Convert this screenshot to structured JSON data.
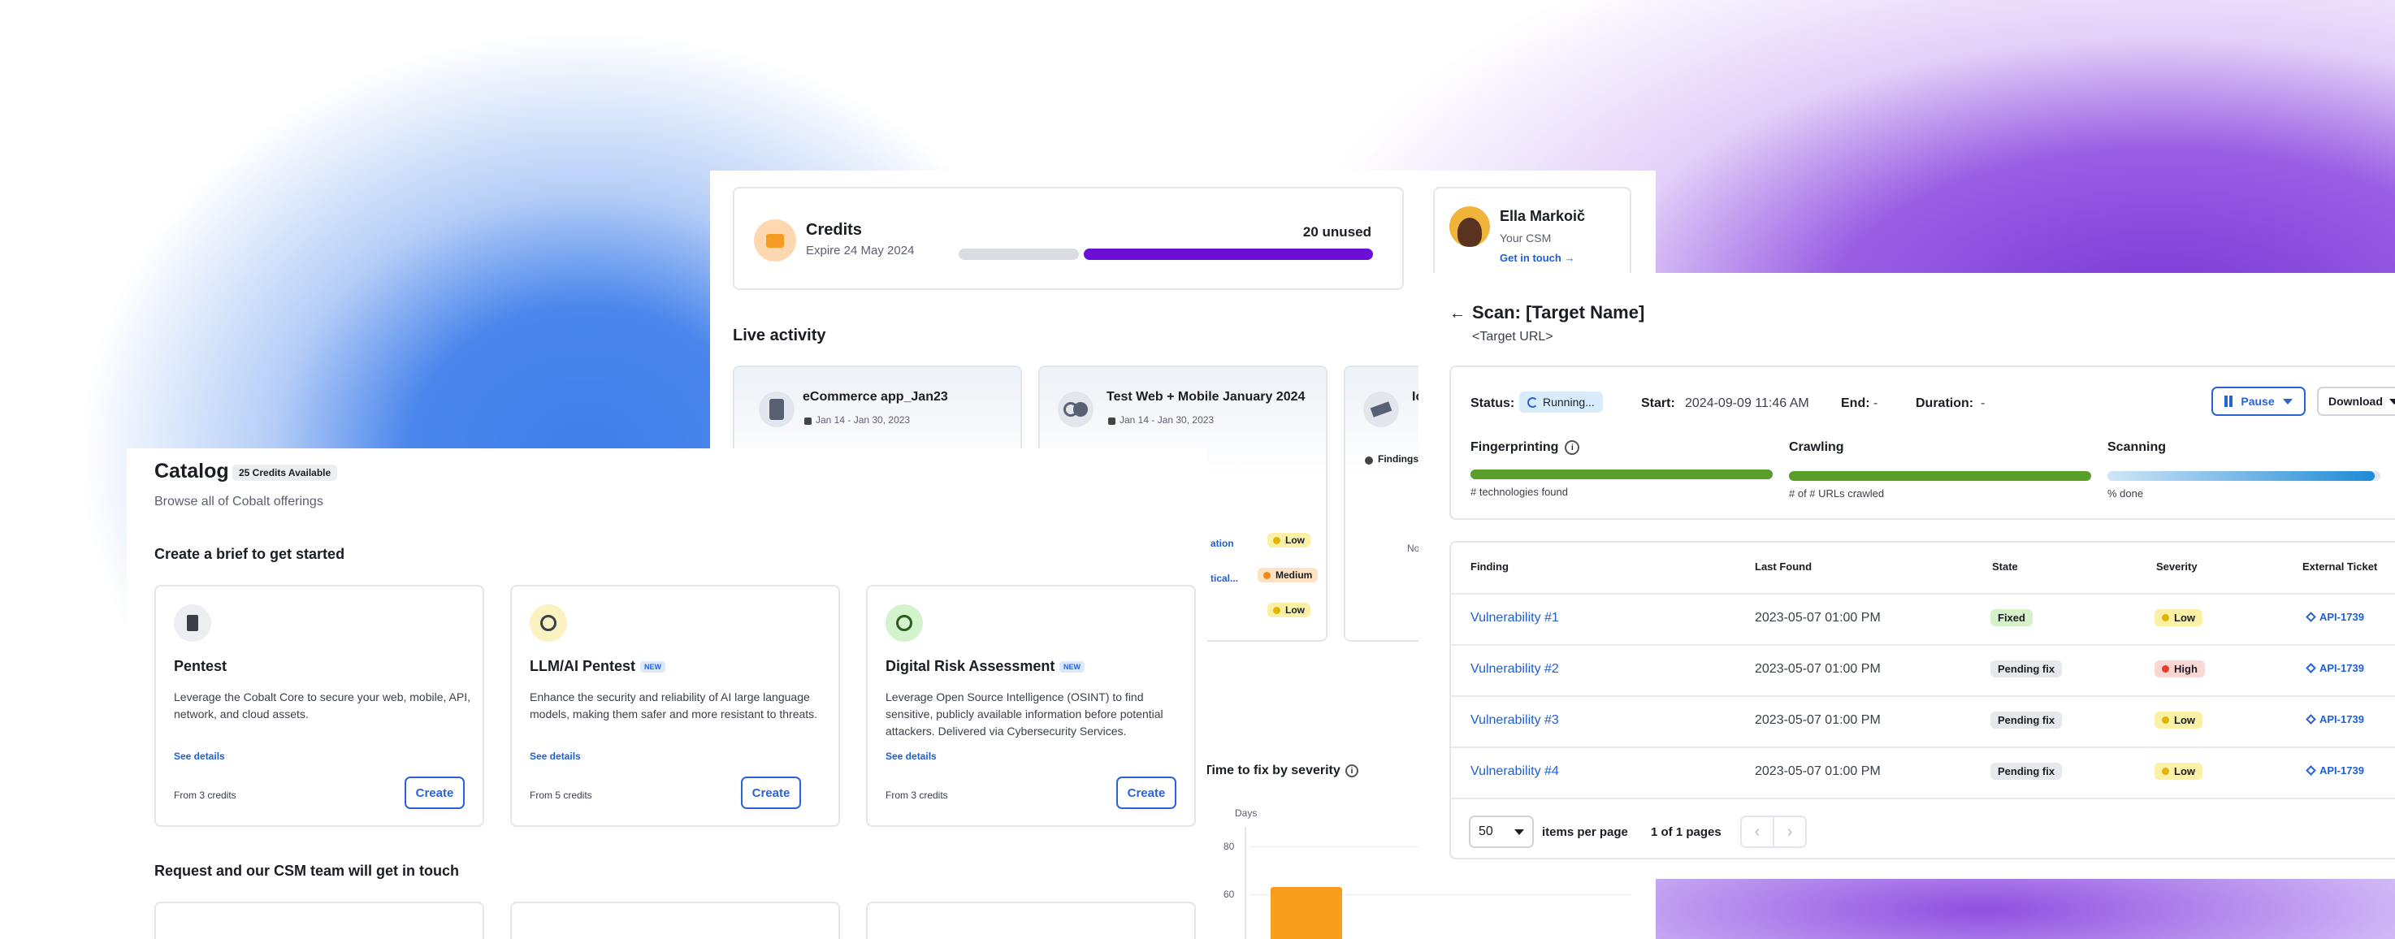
{
  "credits": {
    "title": "Credits",
    "expire": "Expire 24 May 2024",
    "unused": "20 unused",
    "used_fraction": 0.29
  },
  "csm": {
    "name": "Ella Markoič",
    "role": "Your CSM",
    "link": "Get in touch →"
  },
  "live": {
    "title": "Live activity",
    "cards": [
      {
        "name": "eCommerce app_Jan23",
        "dates": "Jan 14 - Jan 30, 2023"
      },
      {
        "name": "Test Web + Mobile January 2024",
        "dates": "Jan 14 - Jan 30, 2023"
      },
      {
        "name": "Io",
        "findings": "Findings"
      }
    ],
    "partial_links": [
      "ation",
      "tical..."
    ],
    "partial_no": "No",
    "severities": [
      "Low",
      "Medium",
      "Low"
    ]
  },
  "catalog": {
    "title": "Catalog",
    "credits_badge": "25 Credits Available",
    "subtitle": "Browse all of Cobalt offerings",
    "section1": "Create a brief to get started",
    "section2": "Request and our CSM team will get in touch",
    "items": [
      {
        "title": "Pentest",
        "new": "",
        "desc": "Leverage the Cobalt Core to secure your web, mobile, API, network, and cloud assets.",
        "details": "See details",
        "credits": "From 3 credits",
        "button": "Create"
      },
      {
        "title": "LLM/AI Pentest",
        "new": "NEW",
        "desc": "Enhance the security and reliability of AI large language models, making them safer and more resistant to threats.",
        "details": "See details",
        "credits": "From 5 credits",
        "button": "Create"
      },
      {
        "title": "Digital Risk Assessment",
        "new": "NEW",
        "desc": "Leverage Open Source Intelligence (OSINT) to find sensitive, publicly available information before potential attackers. Delivered via Cybersecurity Services.",
        "details": "See details",
        "credits": "From 3 credits",
        "button": "Create"
      }
    ]
  },
  "ttf": {
    "title": "Time to fix by severity",
    "ylabel": "Days",
    "ticks": [
      "80",
      "60"
    ]
  },
  "chart_data": {
    "type": "bar",
    "title": "Time to fix by severity",
    "ylabel": "Days",
    "ylim": [
      0,
      90
    ],
    "categories": [
      ""
    ],
    "values": [
      63
    ]
  },
  "scan": {
    "title": "Scan: [Target Name]",
    "url": "<Target URL>",
    "status_label": "Status:",
    "status_value": "Running...",
    "start_label": "Start:",
    "start_value": "2024-09-09 11:46 AM",
    "end_label": "End:",
    "end_value": "-",
    "duration_label": "Duration:",
    "duration_value": "-",
    "pause": "Pause",
    "download": "Download",
    "phases": [
      {
        "name": "Fingerprinting",
        "sub": "# technologies found",
        "progress": 1.0
      },
      {
        "name": "Crawling",
        "sub": "# of # URLs crawled",
        "progress": 1.0
      },
      {
        "name": "Scanning",
        "sub": "% done",
        "progress": 0.98
      }
    ],
    "columns": [
      "Finding",
      "Last Found",
      "State",
      "Severity",
      "External Ticket"
    ],
    "rows": [
      {
        "finding": "Vulnerability #1",
        "last_found": "2023-05-07 01:00 PM",
        "state": "Fixed",
        "severity": "Low",
        "ticket": "API-1739"
      },
      {
        "finding": "Vulnerability #2",
        "last_found": "2023-05-07 01:00 PM",
        "state": "Pending fix",
        "severity": "High",
        "ticket": "API-1739"
      },
      {
        "finding": "Vulnerability #3",
        "last_found": "2023-05-07 01:00 PM",
        "state": "Pending fix",
        "severity": "Low",
        "ticket": "API-1739"
      },
      {
        "finding": "Vulnerability #4",
        "last_found": "2023-05-07 01:00 PM",
        "state": "Pending fix",
        "severity": "Low",
        "ticket": "API-1739"
      }
    ],
    "per_page": "50",
    "per_page_label": "items per page",
    "pages": "1 of 1 pages"
  },
  "colors": {
    "accent": "#2a62d8",
    "purple": "#6a0fd4",
    "green": "#5a9e2a",
    "low": "#fbf1a6",
    "high": "#fbd6d2",
    "medium": "#fde3c4",
    "fixed": "#d6f0c8",
    "pending": "#e6e8ec"
  }
}
